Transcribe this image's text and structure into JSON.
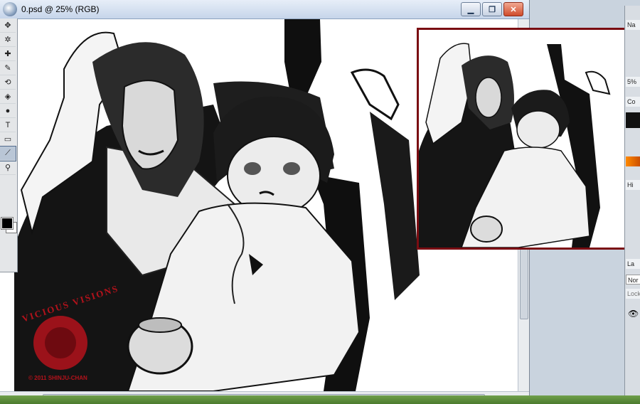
{
  "window": {
    "title": "0.psd @ 25% (RGB)",
    "minimize_glyph": "▁",
    "restore_glyph": "❐",
    "close_glyph": "✕"
  },
  "tools": [
    {
      "name": "move-tool-icon",
      "glyph": "✥"
    },
    {
      "name": "magic-wand-icon",
      "glyph": "✲"
    },
    {
      "name": "healing-brush-icon",
      "glyph": "✚"
    },
    {
      "name": "brush-icon",
      "glyph": "✎"
    },
    {
      "name": "history-brush-icon",
      "glyph": "⟲"
    },
    {
      "name": "paint-bucket-icon",
      "glyph": "◈"
    },
    {
      "name": "burn-tool-icon",
      "glyph": "●"
    },
    {
      "name": "type-tool-icon",
      "glyph": "T"
    },
    {
      "name": "shape-tool-icon",
      "glyph": "▭"
    },
    {
      "name": "eyedropper-icon",
      "glyph": "⟋"
    },
    {
      "name": "zoom-icon",
      "glyph": "⚲"
    }
  ],
  "artwork": {
    "watermark_top": "VICIOUS VISIONS",
    "watermark_credit": "© 2011 SHINJU-CHAN"
  },
  "palettes": {
    "tab_navigator": "Na",
    "tab_info": "5%",
    "tab_color": "Co",
    "tab_history": "Hi",
    "tab_layers": "La",
    "blend_mode": "Nor",
    "lock_label": "Lock"
  },
  "colors": {
    "navigator_border": "#7a0d12",
    "watermark_red": "#b3121b",
    "accent_orange": "#ff8a00"
  }
}
